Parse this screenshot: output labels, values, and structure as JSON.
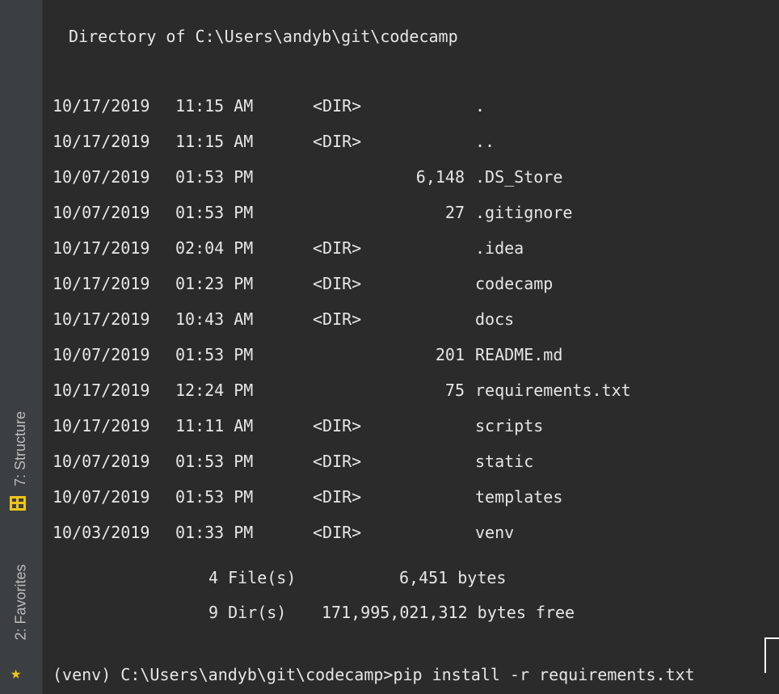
{
  "sidebar": {
    "structure_label": "7: Structure",
    "favorites_label": "2: Favorites",
    "structure_icon": "structure-icon",
    "favorites_icon": "star-icon",
    "star_color": "#f0c419"
  },
  "terminal": {
    "header": "Directory of C:\\Users\\andyb\\git\\codecamp",
    "entries": [
      {
        "date": "10/17/2019",
        "time": "11:15 AM",
        "dir": "<DIR>",
        "size": "",
        "name": "."
      },
      {
        "date": "10/17/2019",
        "time": "11:15 AM",
        "dir": "<DIR>",
        "size": "",
        "name": ".."
      },
      {
        "date": "10/07/2019",
        "time": "01:53 PM",
        "dir": "",
        "size": "6,148",
        "name": ".DS_Store"
      },
      {
        "date": "10/07/2019",
        "time": "01:53 PM",
        "dir": "",
        "size": "27",
        "name": ".gitignore"
      },
      {
        "date": "10/17/2019",
        "time": "02:04 PM",
        "dir": "<DIR>",
        "size": "",
        "name": ".idea"
      },
      {
        "date": "10/17/2019",
        "time": "01:23 PM",
        "dir": "<DIR>",
        "size": "",
        "name": "codecamp"
      },
      {
        "date": "10/17/2019",
        "time": "10:43 AM",
        "dir": "<DIR>",
        "size": "",
        "name": "docs"
      },
      {
        "date": "10/07/2019",
        "time": "01:53 PM",
        "dir": "",
        "size": "201",
        "name": "README.md"
      },
      {
        "date": "10/17/2019",
        "time": "12:24 PM",
        "dir": "",
        "size": "75",
        "name": "requirements.txt"
      },
      {
        "date": "10/17/2019",
        "time": "11:11 AM",
        "dir": "<DIR>",
        "size": "",
        "name": "scripts"
      },
      {
        "date": "10/07/2019",
        "time": "01:53 PM",
        "dir": "<DIR>",
        "size": "",
        "name": "static"
      },
      {
        "date": "10/07/2019",
        "time": "01:53 PM",
        "dir": "<DIR>",
        "size": "",
        "name": "templates"
      },
      {
        "date": "10/03/2019",
        "time": "01:33 PM",
        "dir": "<DIR>",
        "size": "",
        "name": "venv"
      }
    ],
    "summary_files_count": "4 File(s)",
    "summary_files_bytes": "6,451 bytes",
    "summary_dirs_count": "9 Dir(s)",
    "summary_dirs_bytes": "171,995,021,312 bytes free",
    "prompt": "(venv) C:\\Users\\andyb\\git\\codecamp>",
    "command": "pip install -r requirements.txt"
  }
}
